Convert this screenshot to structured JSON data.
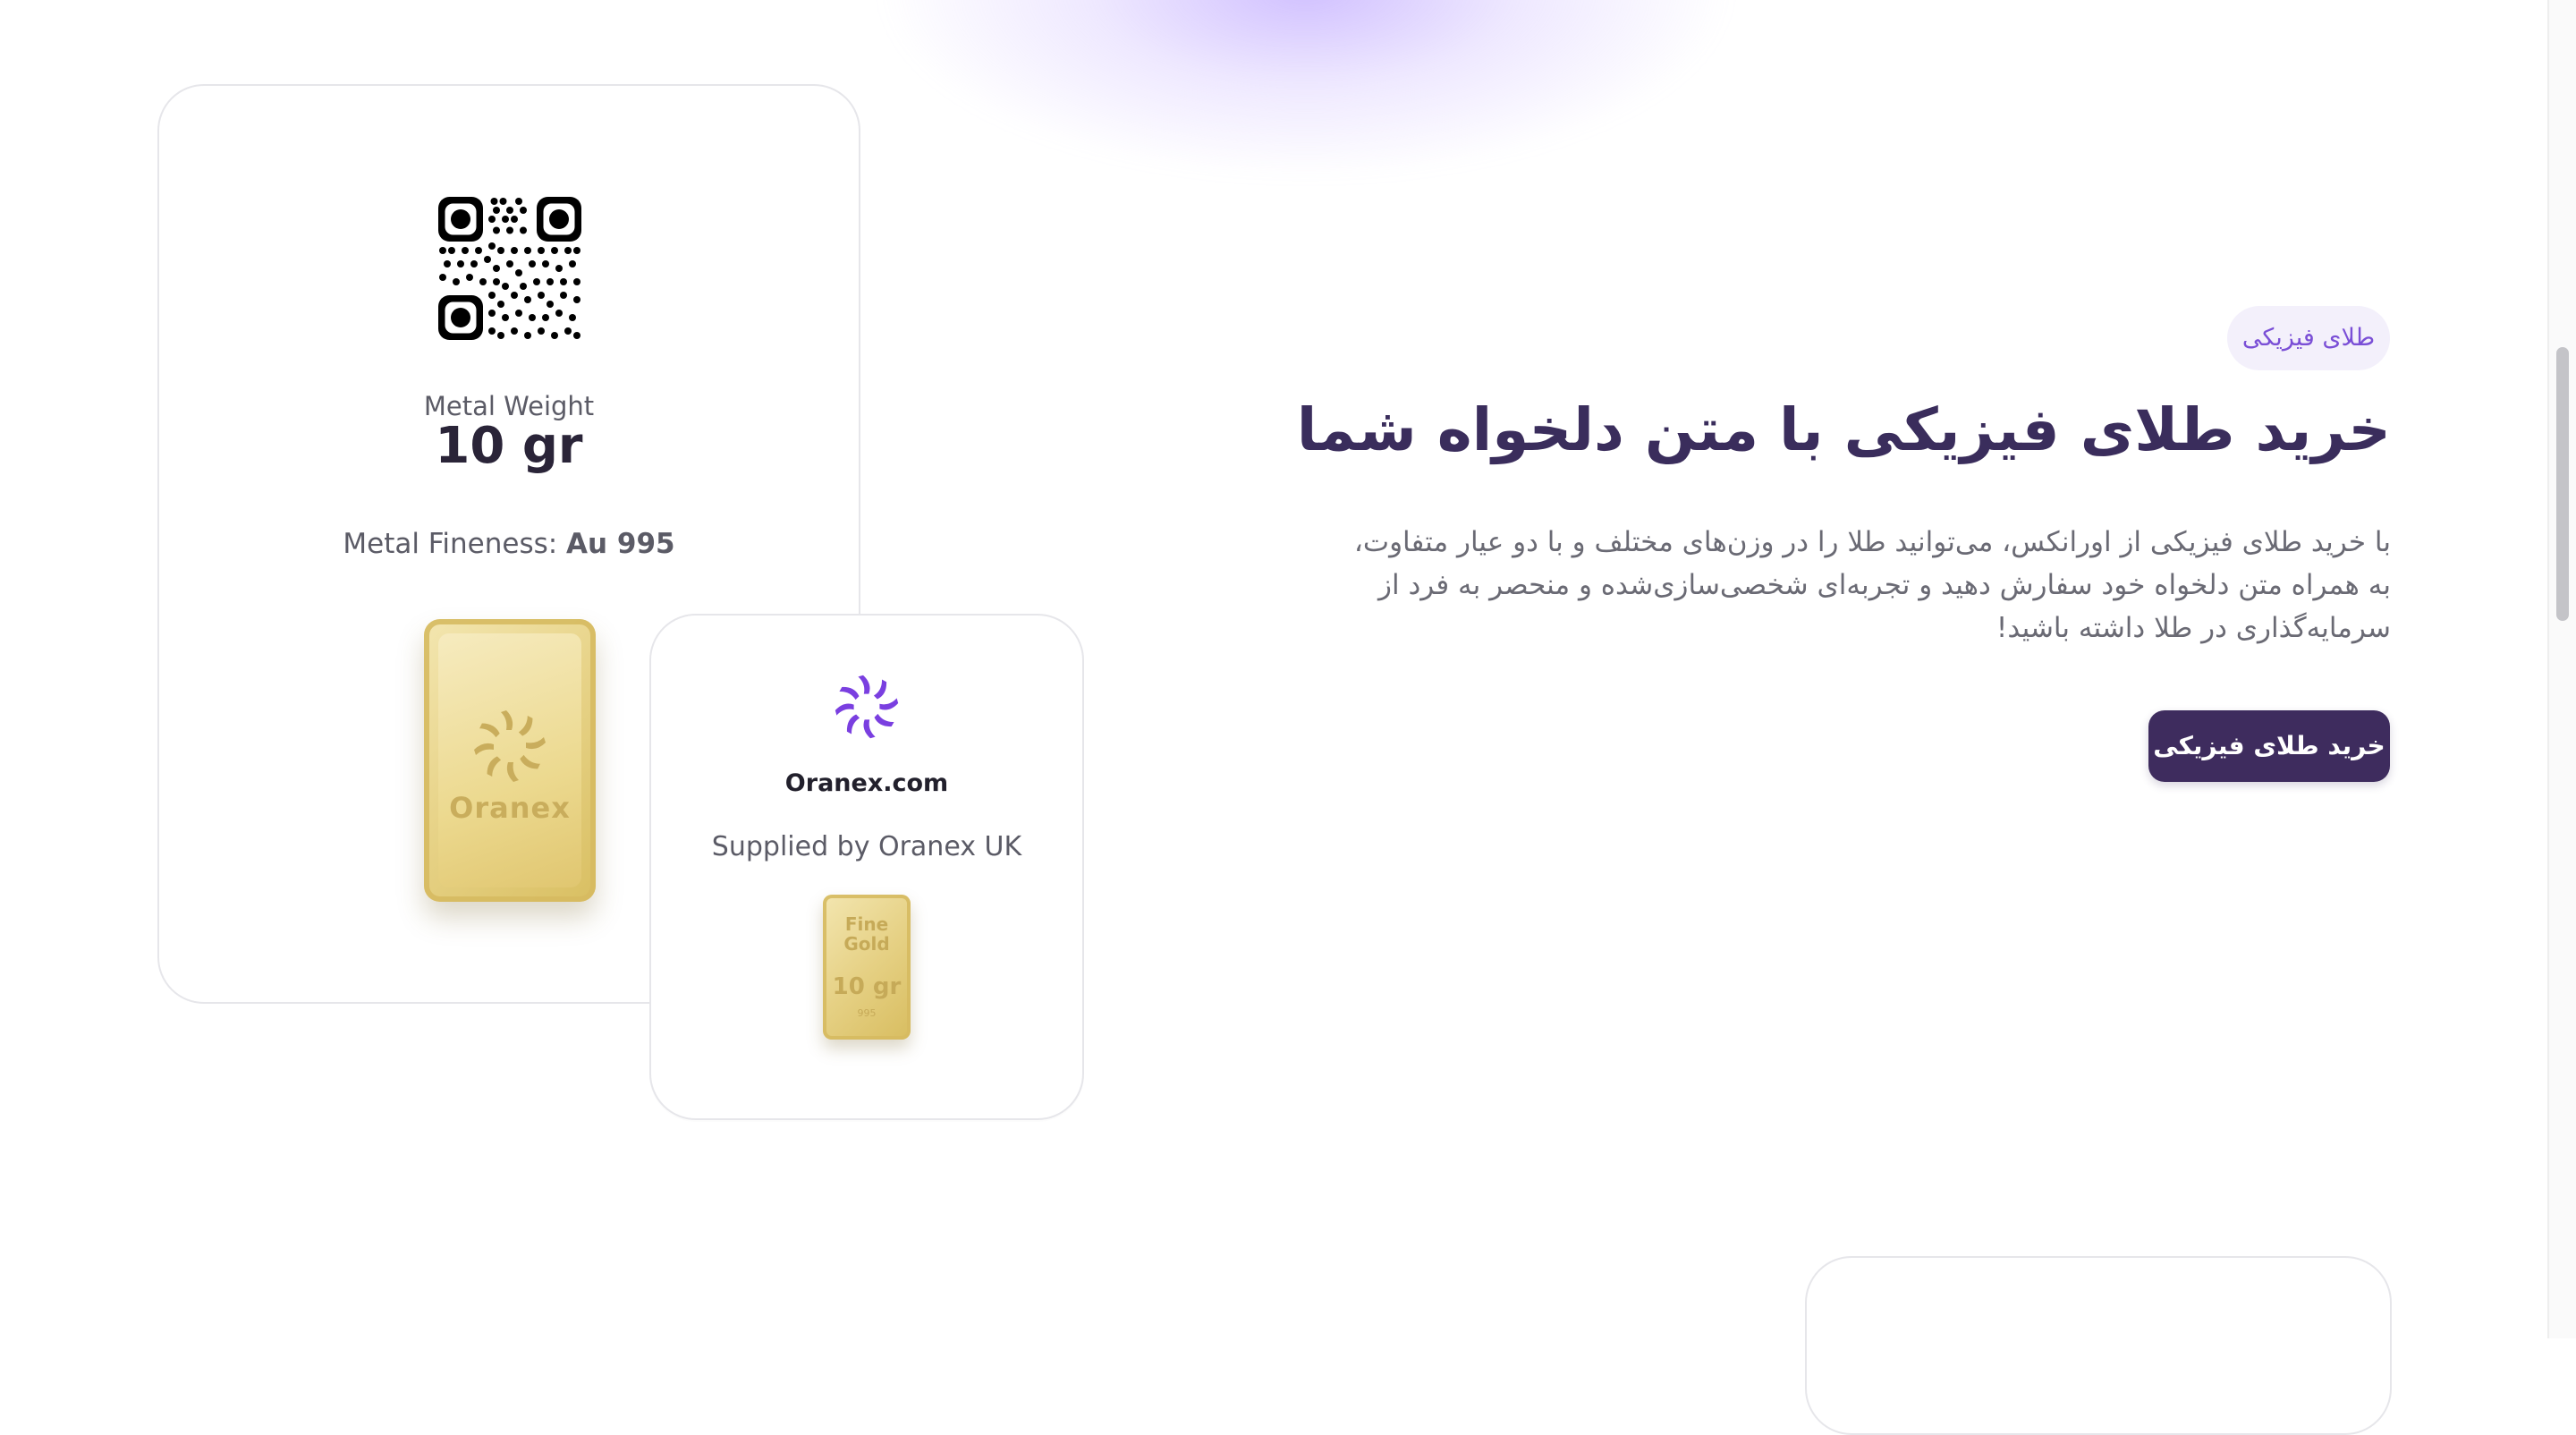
{
  "product_card": {
    "weight_label": "Metal Weight",
    "weight_value": "10 gr",
    "fineness_label": "Metal Fineness: ",
    "fineness_value": "Au 995",
    "bar_brand": "Oranex"
  },
  "supplier_card": {
    "site": "Oranex.com",
    "supplied_by": "Supplied by Oranex UK",
    "bar_line1": "Fine",
    "bar_line2": "Gold",
    "bar_weight": "10 gr",
    "bar_purity": "995"
  },
  "hero": {
    "badge": "طلای فیزیکی",
    "title": "خرید طلای فیزیکی با متن دلخواه شما",
    "description": "با خرید طلای فیزیکی از اورانکس، می‌توانید طلا را در وزن‌های مختلف و با دو عیار متفاوت، به همراه متن دلخواه خود سفارش دهید و تجربه‌ای شخصی‌سازی‌شده و منحصر به فرد از سرمایه‌گذاری در طلا داشته باشید!",
    "cta_label": "خرید طلای فیزیکی"
  },
  "colors": {
    "accent_purple": "#7a4fd6",
    "button_bg": "#3e2c5e",
    "title_color": "#3a2d5c",
    "gold": "#e8d48a"
  },
  "icons": [
    "qr-code-icon",
    "oranex-logo-icon"
  ]
}
